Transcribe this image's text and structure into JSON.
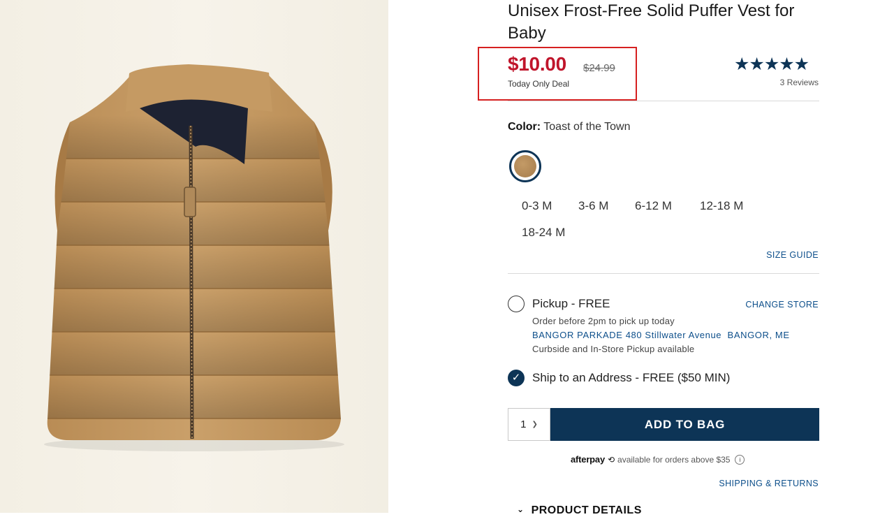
{
  "product": {
    "title": "Unisex Frost-Free Solid Puffer Vest for Baby",
    "sale_price": "$10.00",
    "original_price": "$24.99",
    "deal_label": "Today Only Deal",
    "rating": {
      "stars": "★★★★★",
      "value": 4.8,
      "reviews_label": "3 Reviews"
    }
  },
  "color": {
    "label": "Color:",
    "value": "Toast of the Town",
    "swatch_color": "#b58a58"
  },
  "sizes": [
    "0-3 M",
    "3-6 M",
    "6-12 M",
    "12-18 M",
    "18-24 M"
  ],
  "size_guide_label": "SIZE GUIDE",
  "fulfillment": {
    "pickup": {
      "label": "Pickup - FREE",
      "selected": false,
      "change_store_label": "CHANGE STORE",
      "note": "Order before 2pm to pick up today",
      "store": "BANGOR PARKADE 480 Stillwater Avenue  BANGOR, ME",
      "availability": "Curbside and In-Store Pickup available"
    },
    "ship": {
      "label": "Ship to an Address - FREE ($50 MIN)",
      "selected": true
    }
  },
  "purchase": {
    "quantity": "1",
    "add_to_bag_label": "ADD TO BAG"
  },
  "afterpay": {
    "logo": "afterpay",
    "text": "available for orders above $35",
    "info": "i"
  },
  "shipping_returns_label": "SHIPPING & RETURNS",
  "product_details_label": "PRODUCT DETAILS",
  "colors": {
    "brand_navy": "#0d3456",
    "sale_red": "#c0152b",
    "highlight_border": "#d62020",
    "link_blue": "#0d4f8b"
  }
}
